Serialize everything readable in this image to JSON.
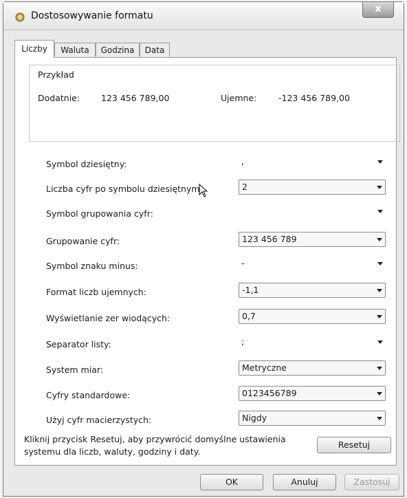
{
  "window": {
    "title": "Dostosowywanie formatu",
    "close_label": "x"
  },
  "tabs": [
    {
      "label": "Liczby",
      "active": true
    },
    {
      "label": "Waluta",
      "active": false
    },
    {
      "label": "Godzina",
      "active": false
    },
    {
      "label": "Data",
      "active": false
    }
  ],
  "sample": {
    "heading": "Przykład",
    "positive_label": "Dodatnie:",
    "positive_value": "123 456 789,00",
    "negative_label": "Ujemne:",
    "negative_value": "-123 456 789,00"
  },
  "settings": [
    {
      "label": "Symbol dziesiętny:",
      "value": ","
    },
    {
      "label": "Liczba cyfr po symbolu dziesiętnym:",
      "value": "2"
    },
    {
      "label": "Symbol grupowania cyfr:",
      "value": ""
    },
    {
      "label": "Grupowanie cyfr:",
      "value": "123 456 789"
    },
    {
      "label": "Symbol znaku minus:",
      "value": "-"
    },
    {
      "label": "Format liczb ujemnych:",
      "value": "-1,1"
    },
    {
      "label": "Wyświetlanie zer wiodących:",
      "value": "0,7"
    },
    {
      "label": "Separator listy:",
      "value": ";"
    },
    {
      "label": "System miar:",
      "value": "Metryczne"
    },
    {
      "label": "Cyfry standardowe:",
      "value": "0123456789"
    },
    {
      "label": "Użyj cyfr macierzystych:",
      "value": "Nigdy"
    }
  ],
  "reset": {
    "info_line1": "Kliknij przycisk Resetuj, aby przywrócić domyślne ustawienia",
    "info_line2": "systemu dla liczb, waluty, godziny i daty.",
    "button": "Resetuj"
  },
  "footer": {
    "ok": "OK",
    "cancel": "Anuluj",
    "apply": "Zastosuj"
  }
}
